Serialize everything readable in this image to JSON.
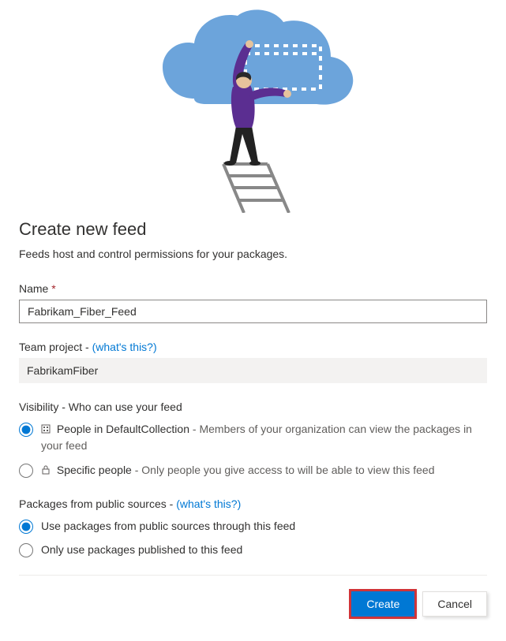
{
  "header": {
    "title": "Create new feed",
    "subtitle": "Feeds host and control permissions for your packages."
  },
  "name_field": {
    "label": "Name",
    "required_mark": "*",
    "value": "Fabrikam_Fiber_Feed"
  },
  "team_project": {
    "label_prefix": "Team project - ",
    "help_link": "(what's this?)",
    "value": "FabrikamFiber"
  },
  "visibility": {
    "label": "Visibility - Who can use your feed",
    "options": [
      {
        "title": "People in DefaultCollection",
        "separator": " - ",
        "desc": "Members of your organization can view the packages in your feed",
        "checked": true
      },
      {
        "title": "Specific people",
        "separator": " - ",
        "desc": "Only people you give access to will be able to view this feed",
        "checked": false
      }
    ]
  },
  "public_sources": {
    "label_prefix": "Packages from public sources - ",
    "help_link": "(what's this?)",
    "options": [
      {
        "label": "Use packages from public sources through this feed",
        "checked": true
      },
      {
        "label": "Only use packages published to this feed",
        "checked": false
      }
    ]
  },
  "buttons": {
    "create": "Create",
    "cancel": "Cancel"
  }
}
